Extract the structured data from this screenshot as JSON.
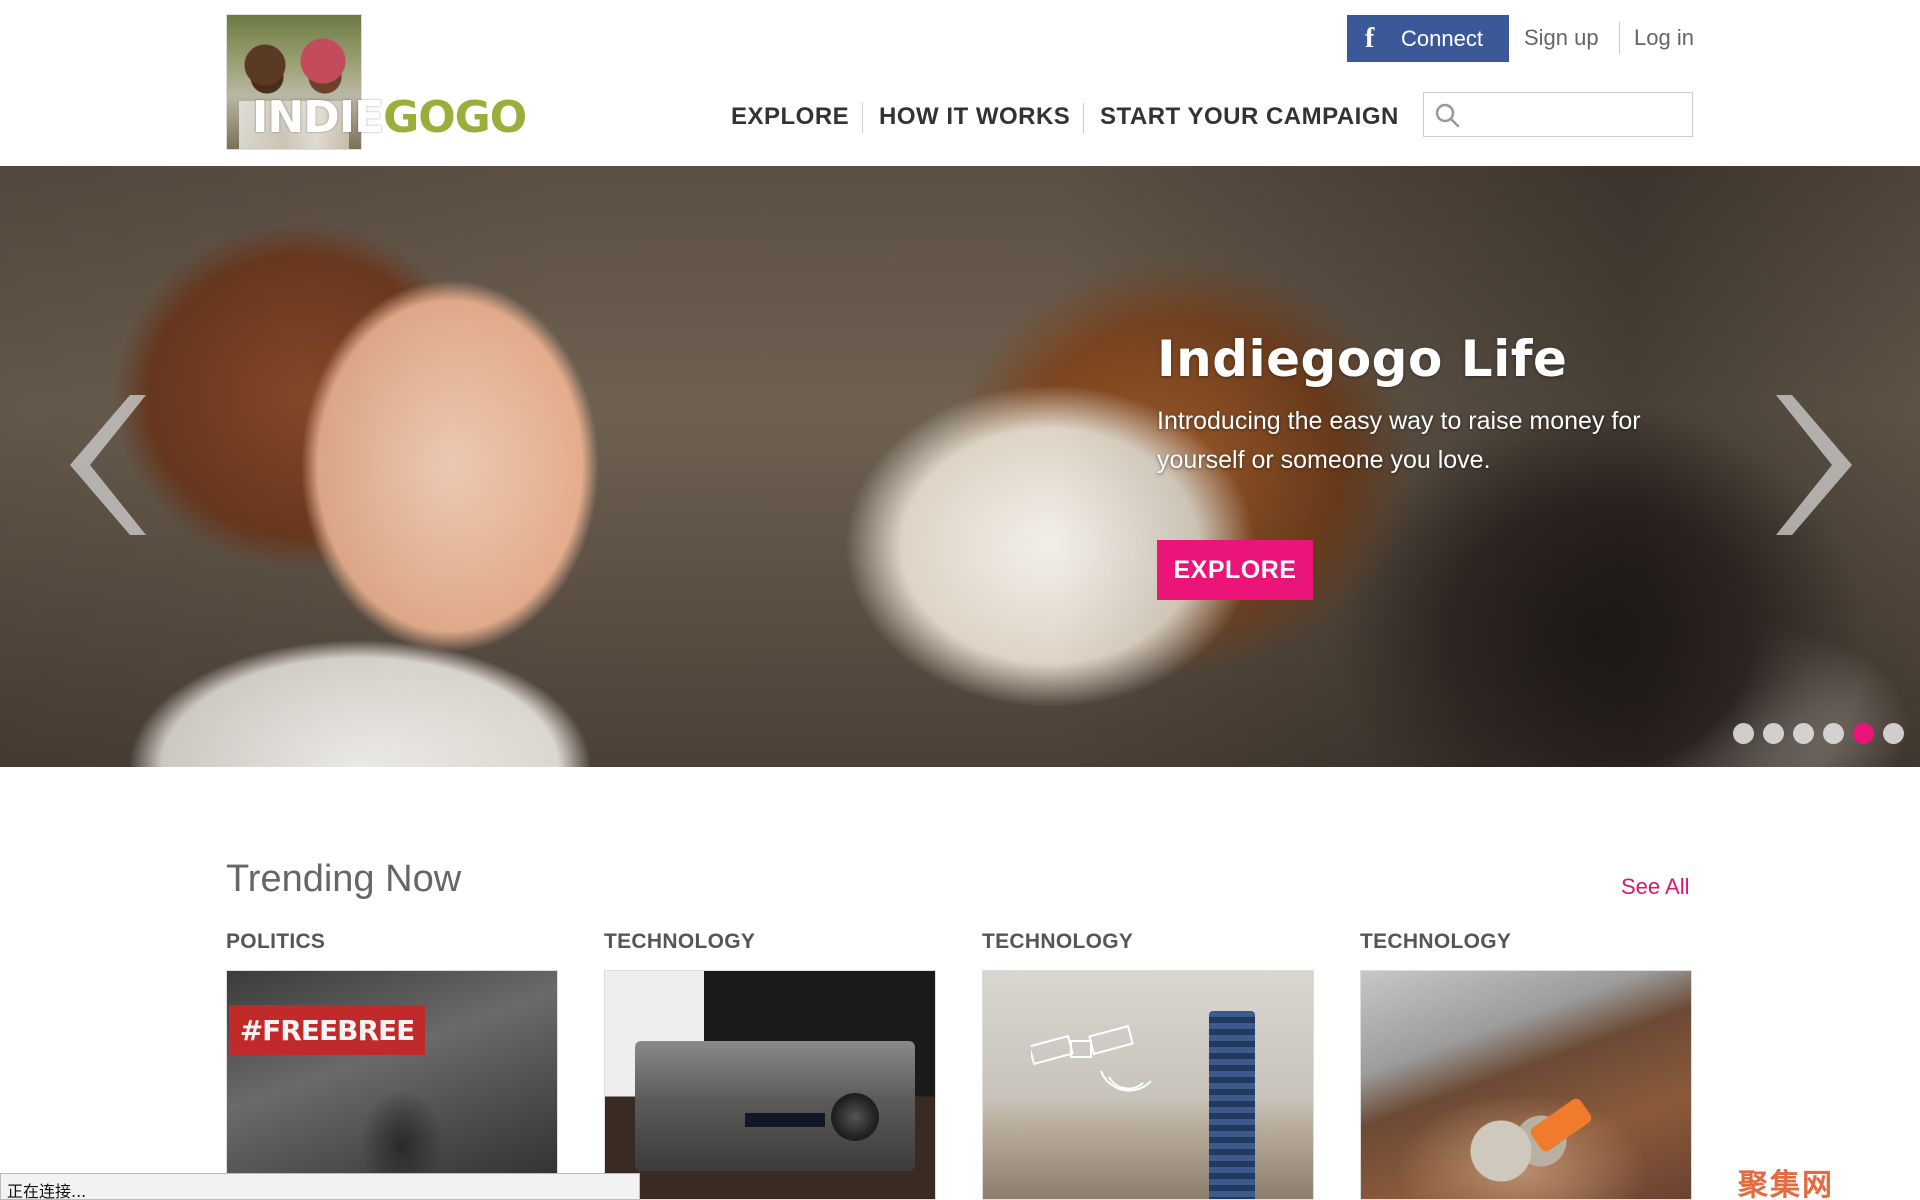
{
  "header": {
    "logo_text_white": "INDIE",
    "logo_text_green": "GOGO",
    "fb_connect_label": "Connect",
    "fb_icon": "f",
    "signup_label": "Sign up",
    "login_label": "Log in",
    "nav": [
      {
        "label": "EXPLORE"
      },
      {
        "label": "HOW IT WORKS"
      },
      {
        "label": "START YOUR CAMPAIGN"
      }
    ],
    "search": {
      "value": "",
      "placeholder": ""
    }
  },
  "hero": {
    "title": "Indiegogo Life",
    "description": "Introducing the easy way to raise money for yourself or someone you love.",
    "cta_label": "EXPLORE",
    "slides_total": 6,
    "active_slide": 5,
    "prev_arrow": "chevron-left-icon",
    "next_arrow": "chevron-right-icon"
  },
  "trending": {
    "title": "Trending Now",
    "see_all_label": "See All",
    "cards": [
      {
        "category": "POLITICS",
        "image_text": "#FREEBREE"
      },
      {
        "category": "TECHNOLOGY"
      },
      {
        "category": "TECHNOLOGY"
      },
      {
        "category": "TECHNOLOGY"
      }
    ]
  },
  "statusbar": {
    "text": "正在连接..."
  },
  "watermark": {
    "text": "聚集网"
  },
  "colors": {
    "accent_pink": "#eb1478",
    "facebook_blue": "#3b5998",
    "logo_green": "#9aae3b",
    "see_all_pink": "#d8196f"
  }
}
